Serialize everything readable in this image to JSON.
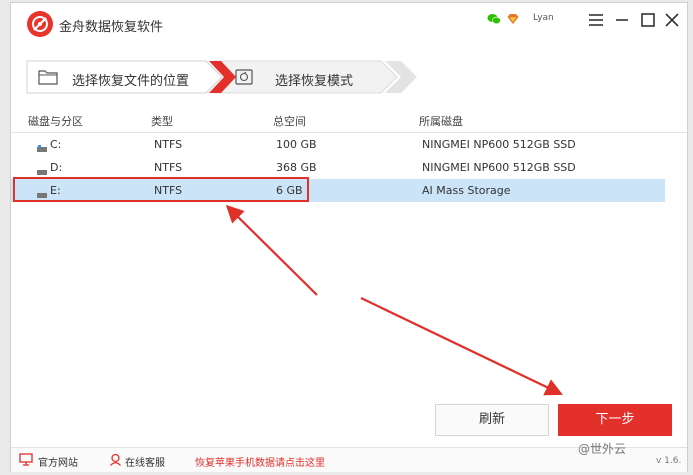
{
  "app": {
    "title": "金舟数据恢复软件",
    "user": "Lyan"
  },
  "steps": [
    {
      "label": "选择恢复文件的位置",
      "active": true
    },
    {
      "label": "选择恢复模式",
      "active": false
    }
  ],
  "table": {
    "headers": [
      "磁盘与分区",
      "类型",
      "总空间",
      "所属磁盘"
    ],
    "rows": [
      {
        "drive": "C:",
        "type": "NTFS",
        "size": "100 GB",
        "disk": "NINGMEI NP600 512GB SSD",
        "selected": false
      },
      {
        "drive": "D:",
        "type": "NTFS",
        "size": "368 GB",
        "disk": "NINGMEI NP600 512GB SSD",
        "selected": false
      },
      {
        "drive": "E:",
        "type": "NTFS",
        "size": "6 GB",
        "disk": "AI Mass Storage",
        "selected": true
      }
    ]
  },
  "buttons": {
    "refresh": "刷新",
    "next": "下一步"
  },
  "footer": {
    "website": "官方网站",
    "support": "在线客服",
    "promo": "恢复苹果手机数据请点击这里"
  },
  "watermark": "@世外云",
  "version": "v 1.6.",
  "colors": {
    "accent": "#e3302a",
    "selected_row": "#cce4f7",
    "annotation": "#e0302a"
  },
  "icons": {
    "logo": "data-recovery-logo",
    "wechat": "wechat-icon",
    "vip": "vip-diamond-icon",
    "menu": "menu-icon",
    "minimize": "minimize-icon",
    "maximize": "maximize-icon",
    "close": "close-icon",
    "folder": "folder-icon",
    "recovery-mode": "recovery-mode-icon",
    "drive": "drive-icon",
    "monitor": "monitor-icon",
    "headset": "headset-icon"
  }
}
